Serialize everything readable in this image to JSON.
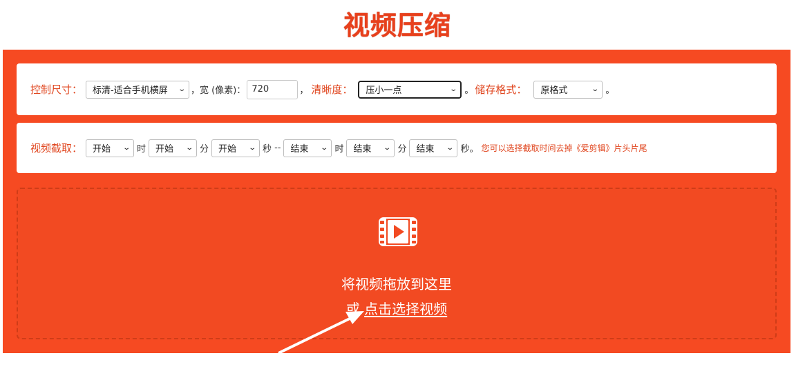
{
  "title": "视频压缩",
  "settings": {
    "size_label": "控制尺寸：",
    "size_value": "标清-适合手机横屏",
    "comma1": "，",
    "width_label": "宽 (像素)：",
    "width_value": "720",
    "comma2": "，",
    "clarity_label": "清晰度：",
    "clarity_value": "压小一点",
    "period": "。",
    "format_label": "储存格式：",
    "format_value": "原格式",
    "period2": "。"
  },
  "clip": {
    "label": "视频截取：",
    "start_hour": "开始",
    "hour_unit": "时",
    "start_min": "开始",
    "min_unit": "分",
    "start_sec": "开始",
    "sec_unit": "秒",
    "dash": "--",
    "end_hour": "结束",
    "hour_unit2": "时",
    "end_min": "结束",
    "min_unit2": "分",
    "end_sec": "结束",
    "sec_unit2": "秒。",
    "hint": "您可以选择截取时间去掉《爱剪辑》片头片尾"
  },
  "dropzone": {
    "icon": "film-icon",
    "text": "将视频拖放到这里",
    "or": "或",
    "link": "点击选择视频"
  },
  "colors": {
    "accent": "#f64a22",
    "title": "#e8401c",
    "label": "#e0461f"
  }
}
